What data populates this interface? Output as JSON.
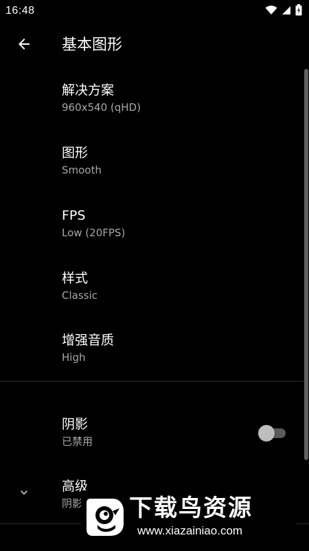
{
  "status_bar": {
    "time": "16:48",
    "icons": [
      "wifi-icon",
      "cell-signal-icon",
      "battery-icon"
    ]
  },
  "toolbar": {
    "back_icon": "arrow-left-icon",
    "title": "基本图形"
  },
  "preferences": [
    {
      "title": "解决方案",
      "summary": "960x540 (qHD)"
    },
    {
      "title": "图形",
      "summary": "Smooth"
    },
    {
      "title": "FPS",
      "summary": "Low (20FPS)"
    },
    {
      "title": "样式",
      "summary": "Classic"
    },
    {
      "title": "增强音质",
      "summary": "High"
    }
  ],
  "shadow": {
    "title": "阴影",
    "summary": "已禁用",
    "enabled": false
  },
  "advanced": {
    "icon": "chevron-down-icon",
    "title": "高级",
    "summary": "阴影"
  },
  "watermark": {
    "brand": "下载鸟资源",
    "url": "www.xiazainiao.com"
  },
  "colors": {
    "background": "#000000",
    "text_primary": "#ffffff",
    "text_secondary": "#a8a8a8",
    "switch_track": "#5b5b5b",
    "switch_thumb": "#bdbdbd"
  }
}
